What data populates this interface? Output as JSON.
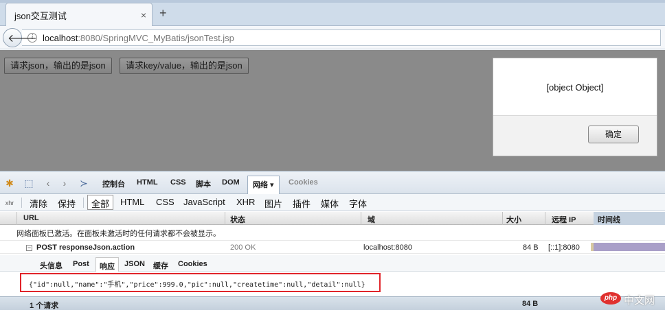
{
  "browser": {
    "tab_title": "json交互测试",
    "tab_close": "×",
    "new_tab": "+",
    "url_host": "localhost",
    "url_rest": ":8080/SpringMVC_MyBatis/jsonTest.jsp"
  },
  "page": {
    "button_json": "请求json，输出的是json",
    "button_kv": "请求key/value，输出的是json",
    "alert_message": "[object Object]",
    "alert_ok": "确定"
  },
  "firebug": {
    "tabs": [
      "控制台",
      "HTML",
      "CSS",
      "脚本",
      "DOM",
      "网络 ▾",
      "Cookies"
    ],
    "filters": [
      "清除",
      "保持",
      "全部",
      "HTML",
      "CSS",
      "JavaScript",
      "XHR",
      "图片",
      "插件",
      "媒体",
      "字体"
    ],
    "columns": {
      "url": "URL",
      "status": "状态",
      "domain": "域",
      "size": "大小",
      "remote_ip": "远程 IP",
      "timeline": "时间线"
    },
    "notice": "网络面板已激活。在面板未激活时的任何请求都不会被显示。",
    "request": {
      "expand": "−",
      "name": "POST responseJson.action",
      "status": "200 OK",
      "domain": "localhost:8080",
      "size": "84 B",
      "remote_ip": "[::1]:8080"
    },
    "subtabs": [
      "头信息",
      "Post",
      "响应",
      "JSON",
      "缓存",
      "Cookies"
    ],
    "response_body": "{\"id\":null,\"name\":\"手机\",\"price\":999.0,\"pic\":null,\"createtime\":null,\"detail\":null}",
    "summary": {
      "count": "1 个请求",
      "size": "84 B"
    }
  },
  "watermark": {
    "logo": "php",
    "text": "中文网"
  },
  "colors": {
    "highlight_box": "#e0242a",
    "timeline_bar": "#a99fc8"
  }
}
